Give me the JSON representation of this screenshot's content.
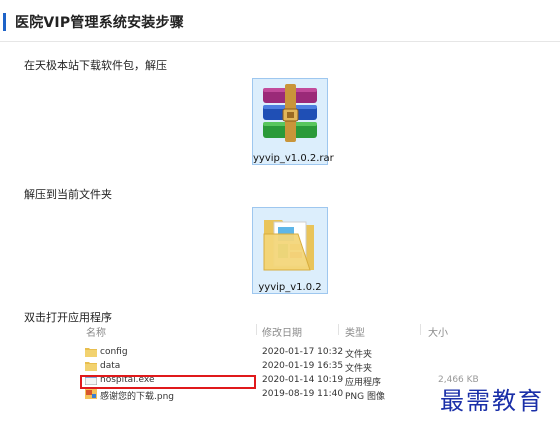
{
  "header": {
    "title": "医院VIP管理系统安装步骤"
  },
  "steps": [
    {
      "text": "在天极本站下载软件包，解压"
    },
    {
      "text": "解压到当前文件夹"
    },
    {
      "text": "双击打开应用程序"
    }
  ],
  "archive": {
    "filename": "yyvip_v1.0.2.rar",
    "icon": "winrar-archive-icon"
  },
  "folder": {
    "name": "yyvip_v1.0.2",
    "icon": "folder-icon"
  },
  "explorer": {
    "columns": [
      "名称",
      "修改日期",
      "类型",
      "大小"
    ],
    "rows": [
      {
        "name": "config",
        "date": "2020-01-17 10:32",
        "type": "文件夹",
        "size": "",
        "icon": "folder-icon"
      },
      {
        "name": "data",
        "date": "2020-01-19 16:35",
        "type": "文件夹",
        "size": "",
        "icon": "folder-icon"
      },
      {
        "name": "hospital.exe",
        "date": "2020-01-14 10:19",
        "type": "应用程序",
        "size": "2,466 KB",
        "icon": "exe-icon"
      },
      {
        "name": "感谢您的下载.png",
        "date": "2019-08-19 11:40",
        "type": "PNG 图像",
        "size": "",
        "icon": "png-icon"
      }
    ]
  },
  "watermark": {
    "text": "最需教育"
  },
  "colors": {
    "accent": "#1e63c8",
    "highlight": "#e0191b",
    "watermark": "#1a2fa8"
  }
}
